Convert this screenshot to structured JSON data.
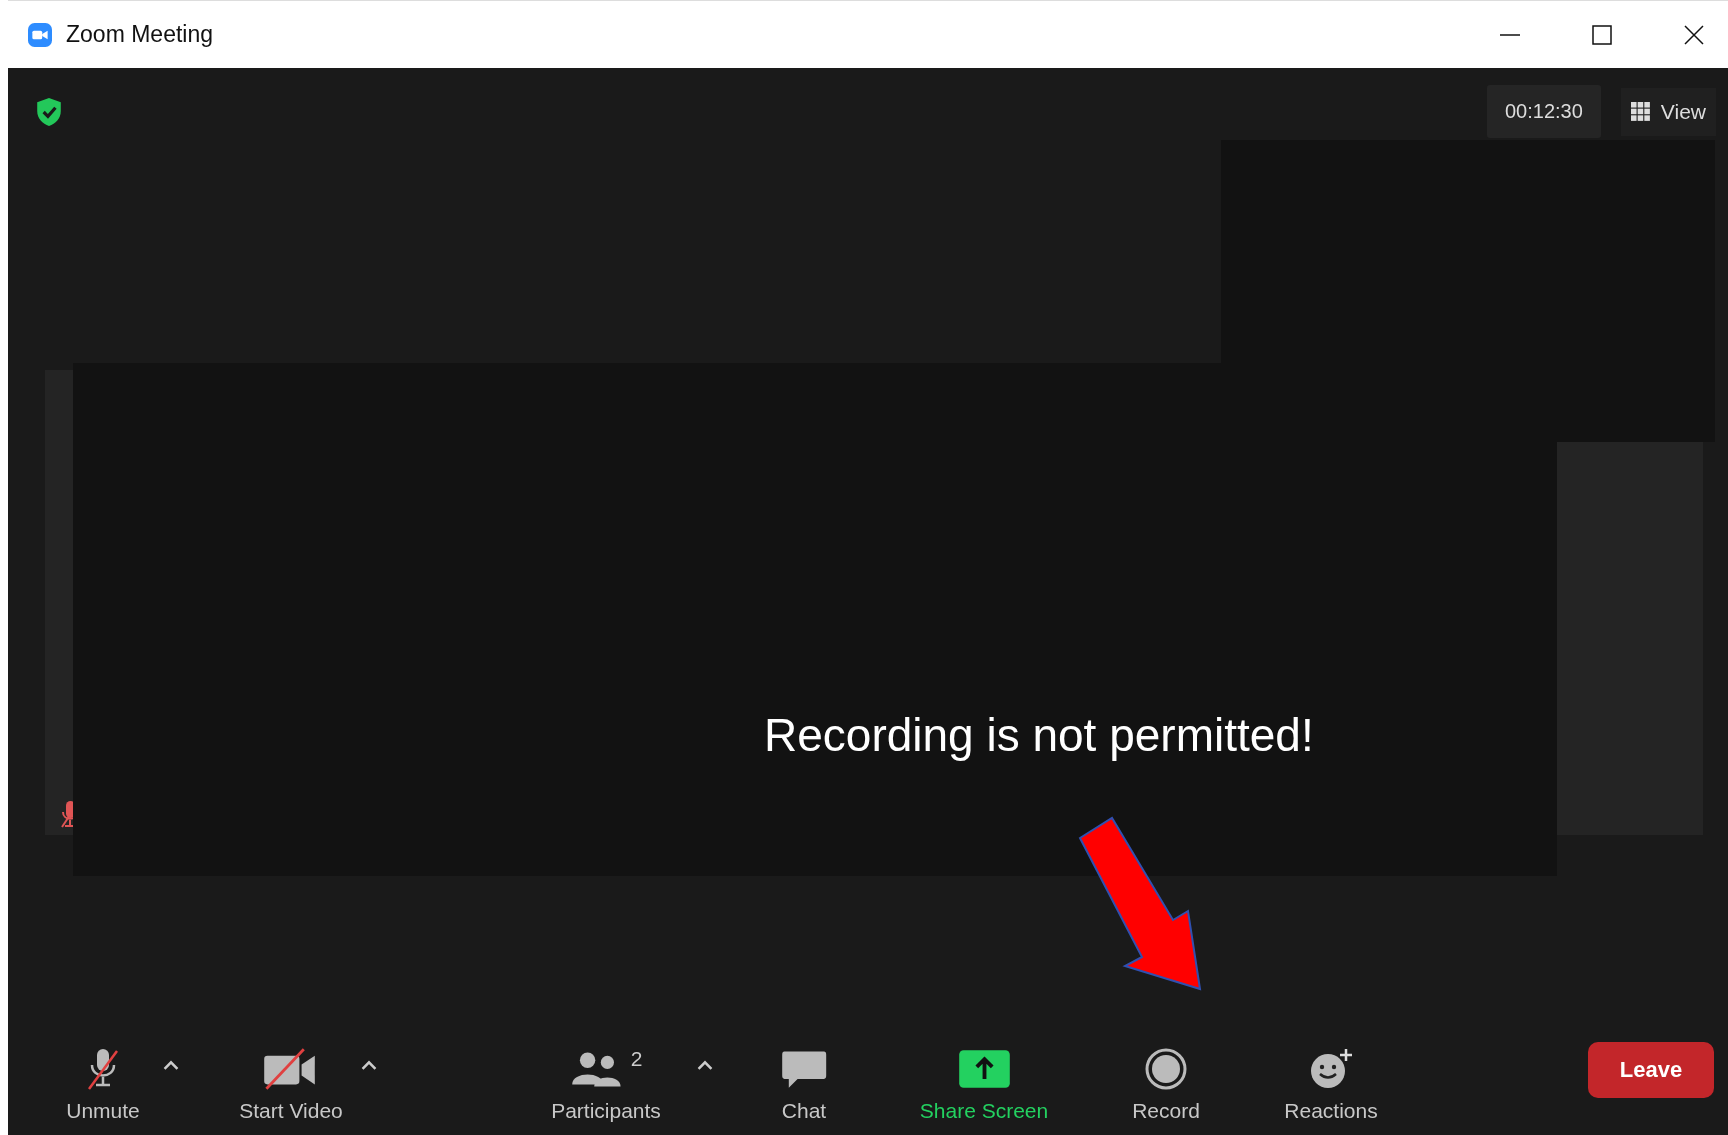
{
  "window": {
    "title": "Zoom Meeting",
    "controls": [
      {
        "kind": "minimize"
      },
      {
        "kind": "maximize"
      },
      {
        "kind": "close"
      }
    ]
  },
  "top_bar": {
    "timer": "00:12:30",
    "view_button": "View"
  },
  "video": {
    "tile_muted": true,
    "annotation": {
      "text": "Recording is not permitted!"
    }
  },
  "toolbar": {
    "items": [
      {
        "kind": "mic",
        "label": "Unmute",
        "off": true,
        "has_menu": true
      },
      {
        "kind": "video",
        "label": "Start Video",
        "off": true,
        "has_menu": true
      },
      {
        "kind": "participants",
        "label": "Participants",
        "count": "2",
        "has_menu": true
      },
      {
        "kind": "chat",
        "label": "Chat",
        "has_menu": false
      },
      {
        "kind": "share",
        "label": "Share Screen",
        "has_menu": false
      },
      {
        "kind": "record",
        "label": "Record",
        "has_menu": false
      },
      {
        "kind": "reactions",
        "label": "Reactions",
        "has_menu": false
      }
    ],
    "leave_button": "Leave"
  }
}
